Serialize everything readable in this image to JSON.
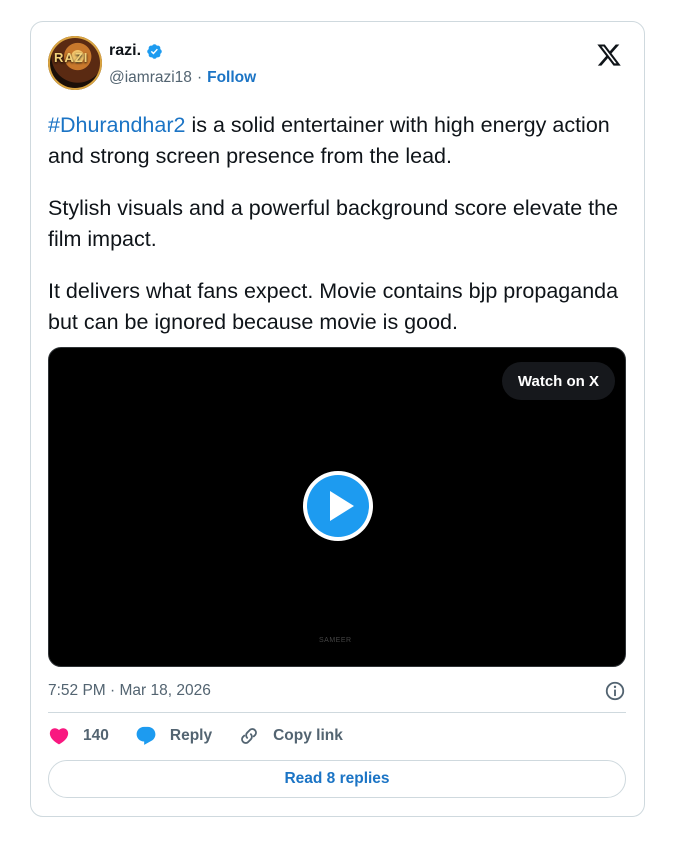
{
  "author": {
    "name": "razi.",
    "handle": "@iamrazi18",
    "separator": "·",
    "follow_label": "Follow",
    "avatar_text": "RAZI"
  },
  "tweet": {
    "hashtag": "#Dhurandhar2",
    "paragraph1_rest": " is a solid entertainer with high energy action and strong screen presence from the lead.",
    "paragraph2": "Stylish visuals and a powerful background score elevate the film impact.",
    "paragraph3": "It delivers what fans expect. Movie contains bjp propaganda but can be ignored because movie is good."
  },
  "video": {
    "watch_label": "Watch on X",
    "watermark": "SAMEER"
  },
  "meta": {
    "timestamp": "7:52 PM · Mar 18, 2026"
  },
  "actions": {
    "like_count": "140",
    "reply_label": "Reply",
    "copy_link_label": "Copy link",
    "read_replies_label": "Read 8 replies"
  },
  "icons": {
    "verified": "verified-badge-icon",
    "x_logo": "x-logo-icon",
    "play": "play-icon",
    "info": "info-icon",
    "like": "heart-icon",
    "reply": "reply-bubble-icon",
    "copy_link": "link-icon"
  },
  "colors": {
    "link_blue": "#1b74c5",
    "like_pink": "#f91880",
    "play_blue": "#1d9bf0",
    "muted_text": "#536471",
    "border": "#cfd9de"
  }
}
